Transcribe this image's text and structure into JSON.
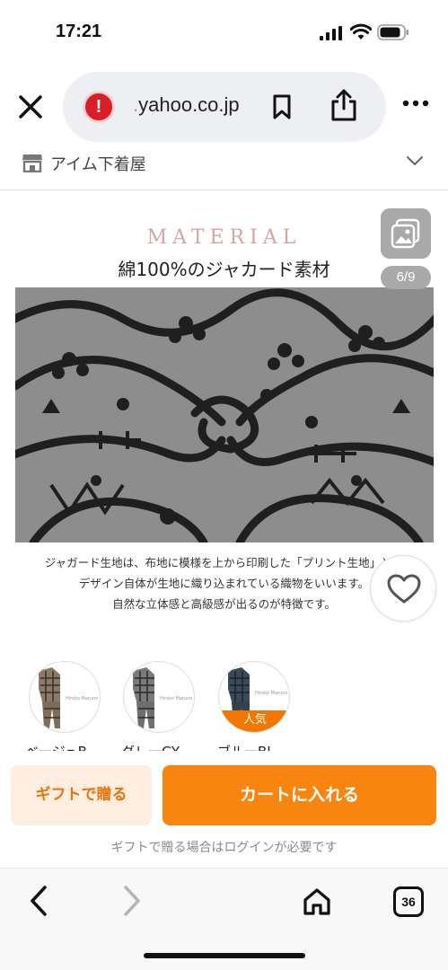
{
  "status_bar": {
    "time": "17:21",
    "icons": [
      "signal-icon",
      "wifi-icon",
      "battery-icon"
    ]
  },
  "browser": {
    "url_prefix": ".",
    "url_domain": "yahoo.co.jp",
    "security_icon": "warning-icon",
    "warning_glyph": "!",
    "icons": [
      "close-icon",
      "bookmark-icon",
      "share-icon",
      "more-icon"
    ]
  },
  "store": {
    "name": "アイム下着屋",
    "icon": "store-icon",
    "chevron": "chevron-down-icon"
  },
  "product_image": {
    "title": "MATERIAL",
    "subtitle": "綿100%のジャカード素材",
    "counter": "6/9",
    "description": [
      "ジャガード生地は、布地に模様を上から印刷した「プリント生地」とは",
      "デザイン自体が生地に織り込まれている織物をいいます。",
      "自然な立体感と高級感が出るのが特徴です。"
    ]
  },
  "color_options": [
    {
      "label": "ベージュB",
      "badge": "",
      "brand": "Hiroko Maruno"
    },
    {
      "label": "グレーGY",
      "badge": "",
      "brand": "Hiroko Maruno"
    },
    {
      "label": "ブルーBL",
      "badge": "人気",
      "brand": "Hiroko Maruno"
    }
  ],
  "actions": {
    "gift_label": "ギフトで贈る",
    "cart_label": "カートに入れる",
    "note": "ギフトで贈る場合はログインが必要です"
  },
  "browser_nav": {
    "tabs_count": "36"
  },
  "colors": {
    "accent": "#f7850f",
    "gift_bg": "#fdeee0",
    "warning": "#d81e26",
    "material_title": "#d4a5a5"
  }
}
